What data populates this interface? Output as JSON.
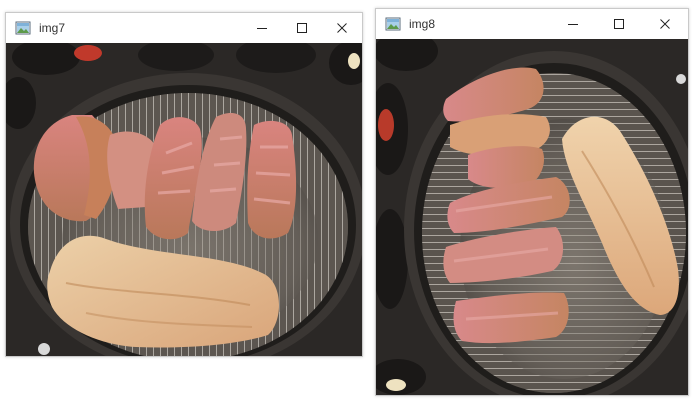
{
  "windows": [
    {
      "title": "img7",
      "icon": "image-viewer-icon",
      "controls": [
        "minimize-icon",
        "maximize-icon",
        "close-icon"
      ],
      "image": "grilled-pork-belly-on-charcoal-grill"
    },
    {
      "title": "img8",
      "icon": "image-viewer-icon",
      "controls": [
        "minimize-icon",
        "maximize-icon",
        "close-icon"
      ],
      "image": "grilled-pork-belly-on-charcoal-grill-closeup"
    }
  ],
  "colors": {
    "titlebar": "#ffffff",
    "title_text": "#333333",
    "window_border": "#c9c9c9",
    "grill_dark": "#2b2826",
    "meat_pink": "#d98c8f",
    "meat_crust": "#c98e5b"
  }
}
